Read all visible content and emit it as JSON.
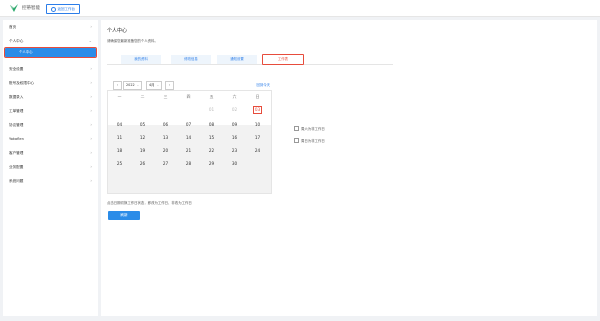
{
  "header": {
    "brand": "控蒂智能",
    "back_label": "返回工作台"
  },
  "sidebar": {
    "items": [
      {
        "label": "首页",
        "chev": "›"
      },
      {
        "label": "个人中心",
        "chev": "⌄"
      },
      {
        "label": "安全设置",
        "chev": "›"
      },
      {
        "label": "账号及权限中心",
        "chev": "›"
      },
      {
        "label": "数据录入",
        "chev": "›"
      },
      {
        "label": "工单管理",
        "chev": "›"
      },
      {
        "label": "协议管理",
        "chev": "›"
      },
      {
        "label": "Yokaflen",
        "chev": "›"
      },
      {
        "label": "客户管理",
        "chev": "›"
      },
      {
        "label": "业务配置",
        "chev": "›"
      },
      {
        "label": "系统问题",
        "chev": "›"
      }
    ],
    "subitem": "个人中心"
  },
  "main": {
    "title": "个人中心",
    "subtitle": "请确保您最新准备您的个人资料。",
    "tabs": [
      {
        "label": "我的资料",
        "active": false
      },
      {
        "label": "修改信息",
        "active": false
      },
      {
        "label": "通知设置",
        "active": false
      },
      {
        "label": "工作表",
        "active": true
      }
    ],
    "calendar": {
      "prev": "‹",
      "next": "›",
      "year": "2022",
      "month": "4月",
      "today_link": "回到今天",
      "weekdays": [
        "一",
        "二",
        "三",
        "四",
        "五",
        "六",
        "日"
      ],
      "rows": [
        [
          "",
          "",
          "",
          "",
          "01",
          "02",
          "03"
        ],
        [
          "04",
          "05",
          "06",
          "07",
          "08",
          "09",
          "10"
        ],
        [
          "11",
          "12",
          "13",
          "14",
          "15",
          "16",
          "17"
        ],
        [
          "18",
          "19",
          "20",
          "21",
          "22",
          "23",
          "24"
        ],
        [
          "25",
          "26",
          "27",
          "28",
          "29",
          "30",
          ""
        ]
      ],
      "selected_day": "03"
    },
    "options": [
      "周六为非工作日",
      "周日为非工作日"
    ],
    "note": "点击日期切换工作日状态，即改为工作日、非改为工作日",
    "refresh_label": "刷新"
  }
}
